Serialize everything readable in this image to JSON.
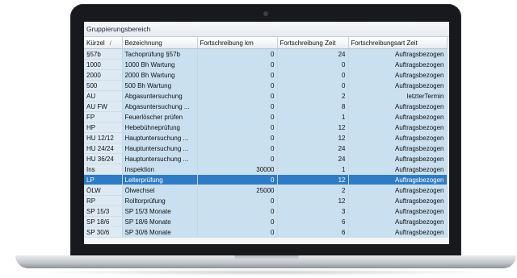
{
  "panel": {
    "group_label": "Gruppierungsbereich"
  },
  "grid": {
    "columns": [
      "Kürzel",
      "Bezeichnung",
      "Fortschreibung km",
      "Fortschreibung Zeit",
      "Fortschreibungsart Zeit"
    ],
    "sort_indicator": "/",
    "selected_row_index": 12,
    "rows": [
      [
        "§57b",
        "Tachoprüfung §57b",
        "0",
        "24",
        "Auftragsbezogen"
      ],
      [
        "1000",
        "1000 Bh Wartung",
        "0",
        "0",
        "Auftragsbezogen"
      ],
      [
        "2000",
        "2000 Bh Wartung",
        "0",
        "0",
        "Auftragsbezogen"
      ],
      [
        "500",
        "500 Bh Wartung",
        "0",
        "0",
        "Auftragsbezogen"
      ],
      [
        "AU",
        "Abgasuntersuchung",
        "0",
        "2",
        "letzterTermin"
      ],
      [
        "AU FW",
        "Abgasuntersuchung ...",
        "0",
        "8",
        "Auftragsbezogen"
      ],
      [
        "FP",
        "Feuerlöscher prüfen",
        "0",
        "1",
        "Auftragsbezogen"
      ],
      [
        "HP",
        "Hebebühneprüfung",
        "0",
        "12",
        "Auftragsbezogen"
      ],
      [
        "HU 12/12",
        "Hauptuntersuchung ...",
        "0",
        "12",
        "Auftragsbezogen"
      ],
      [
        "HU 24/24",
        "Hauptuntersuchung ...",
        "0",
        "24",
        "Auftragsbezogen"
      ],
      [
        "HU 36/24",
        "Hauptuntersuchung ...",
        "0",
        "24",
        "Auftragsbezogen"
      ],
      [
        "Ins",
        "Inspektion",
        "30000",
        "1",
        "Auftragsbezogen"
      ],
      [
        "LP",
        "Leiterprüfung",
        "0",
        "12",
        "Auftragsbezogen"
      ],
      [
        "ÖLW",
        "Ölwechsel",
        "25000",
        "2",
        "Auftragsbezogen"
      ],
      [
        "RP",
        "Rolltorprüfung",
        "0",
        "12",
        "Auftragsbezogen"
      ],
      [
        "SP 15/3",
        "SP 15/3 Monate",
        "0",
        "3",
        "Auftragsbezogen"
      ],
      [
        "SP 18/6",
        "SP 18/6 Monate",
        "0",
        "6",
        "Auftragsbezogen"
      ],
      [
        "SP 30/6",
        "SP 30/6 Monate",
        "0",
        "6",
        "Auftragsbezogen"
      ]
    ]
  }
}
